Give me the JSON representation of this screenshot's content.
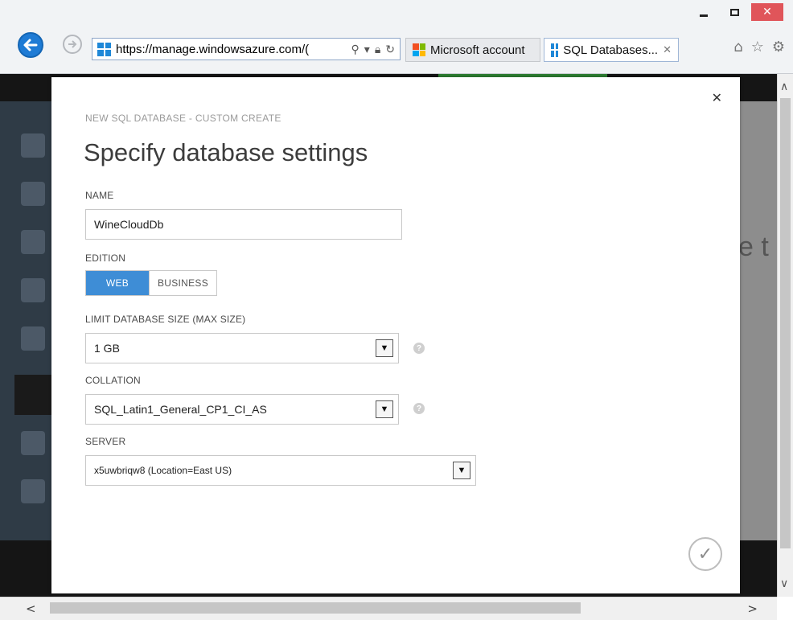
{
  "browser": {
    "address_scheme": "https://",
    "address_host": "manage.windowsazure.com/",
    "address_rest": "(",
    "tabs": [
      {
        "label": "Microsoft account"
      },
      {
        "label": "SQL Databases..."
      }
    ],
    "brand_color": "#1f88d8"
  },
  "background": {
    "partial_text": "e t"
  },
  "dialog": {
    "caption": "NEW SQL DATABASE - CUSTOM CREATE",
    "heading": "Specify database settings",
    "name": {
      "label": "NAME",
      "value": "WineCloudDb"
    },
    "edition": {
      "label": "EDITION",
      "options": [
        "WEB",
        "BUSINESS"
      ],
      "selected": "WEB"
    },
    "max_size": {
      "label": "LIMIT DATABASE SIZE (MAX SIZE)",
      "value": "1 GB"
    },
    "collation": {
      "label": "COLLATION",
      "value": "SQL_Latin1_General_CP1_CI_AS"
    },
    "server": {
      "label": "SERVER",
      "value": "x5uwbriqw8 (Location=East US)"
    },
    "accent_color": "#3e8dd6"
  }
}
